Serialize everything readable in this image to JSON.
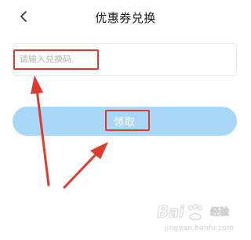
{
  "header": {
    "back_icon": "chevron-left-icon",
    "title": "优惠券兑换"
  },
  "form": {
    "code_placeholder": "请输入兑换码",
    "code_value": ""
  },
  "submit": {
    "label": "领取",
    "color": "#a8d7f7"
  },
  "annotation": {
    "color": "#e03a2e"
  },
  "watermark": {
    "brand": "Bai",
    "brand_suffix": "经验",
    "url": "jingyan.baidu.com"
  }
}
